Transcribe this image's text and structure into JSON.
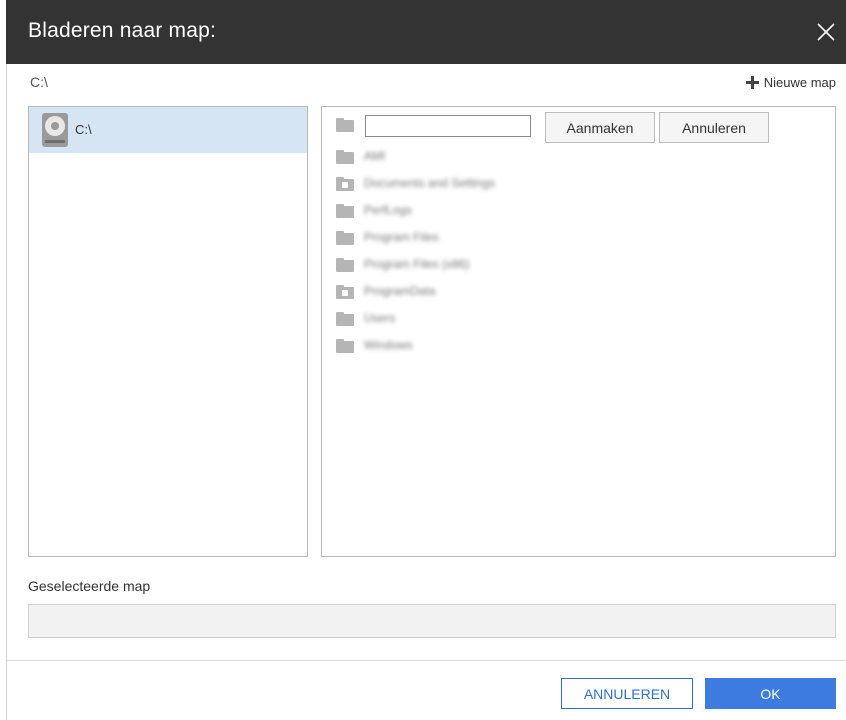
{
  "dialog": {
    "title": "Bladeren naar map:",
    "close_icon": "close-icon"
  },
  "path": {
    "current": "C:\\"
  },
  "toolbar": {
    "new_folder_label": "Nieuwe map",
    "new_folder_icon": "plus-icon"
  },
  "tree": {
    "items": [
      {
        "label": "C:\\",
        "icon": "hard-drive-icon",
        "selected": true
      }
    ]
  },
  "folder_panel": {
    "new_name_input": {
      "value": "",
      "placeholder": ""
    },
    "create_label": "Aanmaken",
    "cancel_label": "Annuleren",
    "folders": [
      {
        "name": "AMI",
        "locked": false
      },
      {
        "name": "Documents and Settings",
        "locked": true
      },
      {
        "name": "PerfLogs",
        "locked": false
      },
      {
        "name": "Program Files",
        "locked": false
      },
      {
        "name": "Program Files (x86)",
        "locked": false
      },
      {
        "name": "ProgramData",
        "locked": true
      },
      {
        "name": "Users",
        "locked": false
      },
      {
        "name": "Windows",
        "locked": false
      }
    ]
  },
  "selected_folder": {
    "label": "Geselecteerde map",
    "value": ""
  },
  "footer": {
    "cancel_label": "ANNULEREN",
    "ok_label": "OK"
  },
  "colors": {
    "title_bar": "#333333",
    "selection": "#d5e5f3",
    "primary": "#3d7be0"
  }
}
